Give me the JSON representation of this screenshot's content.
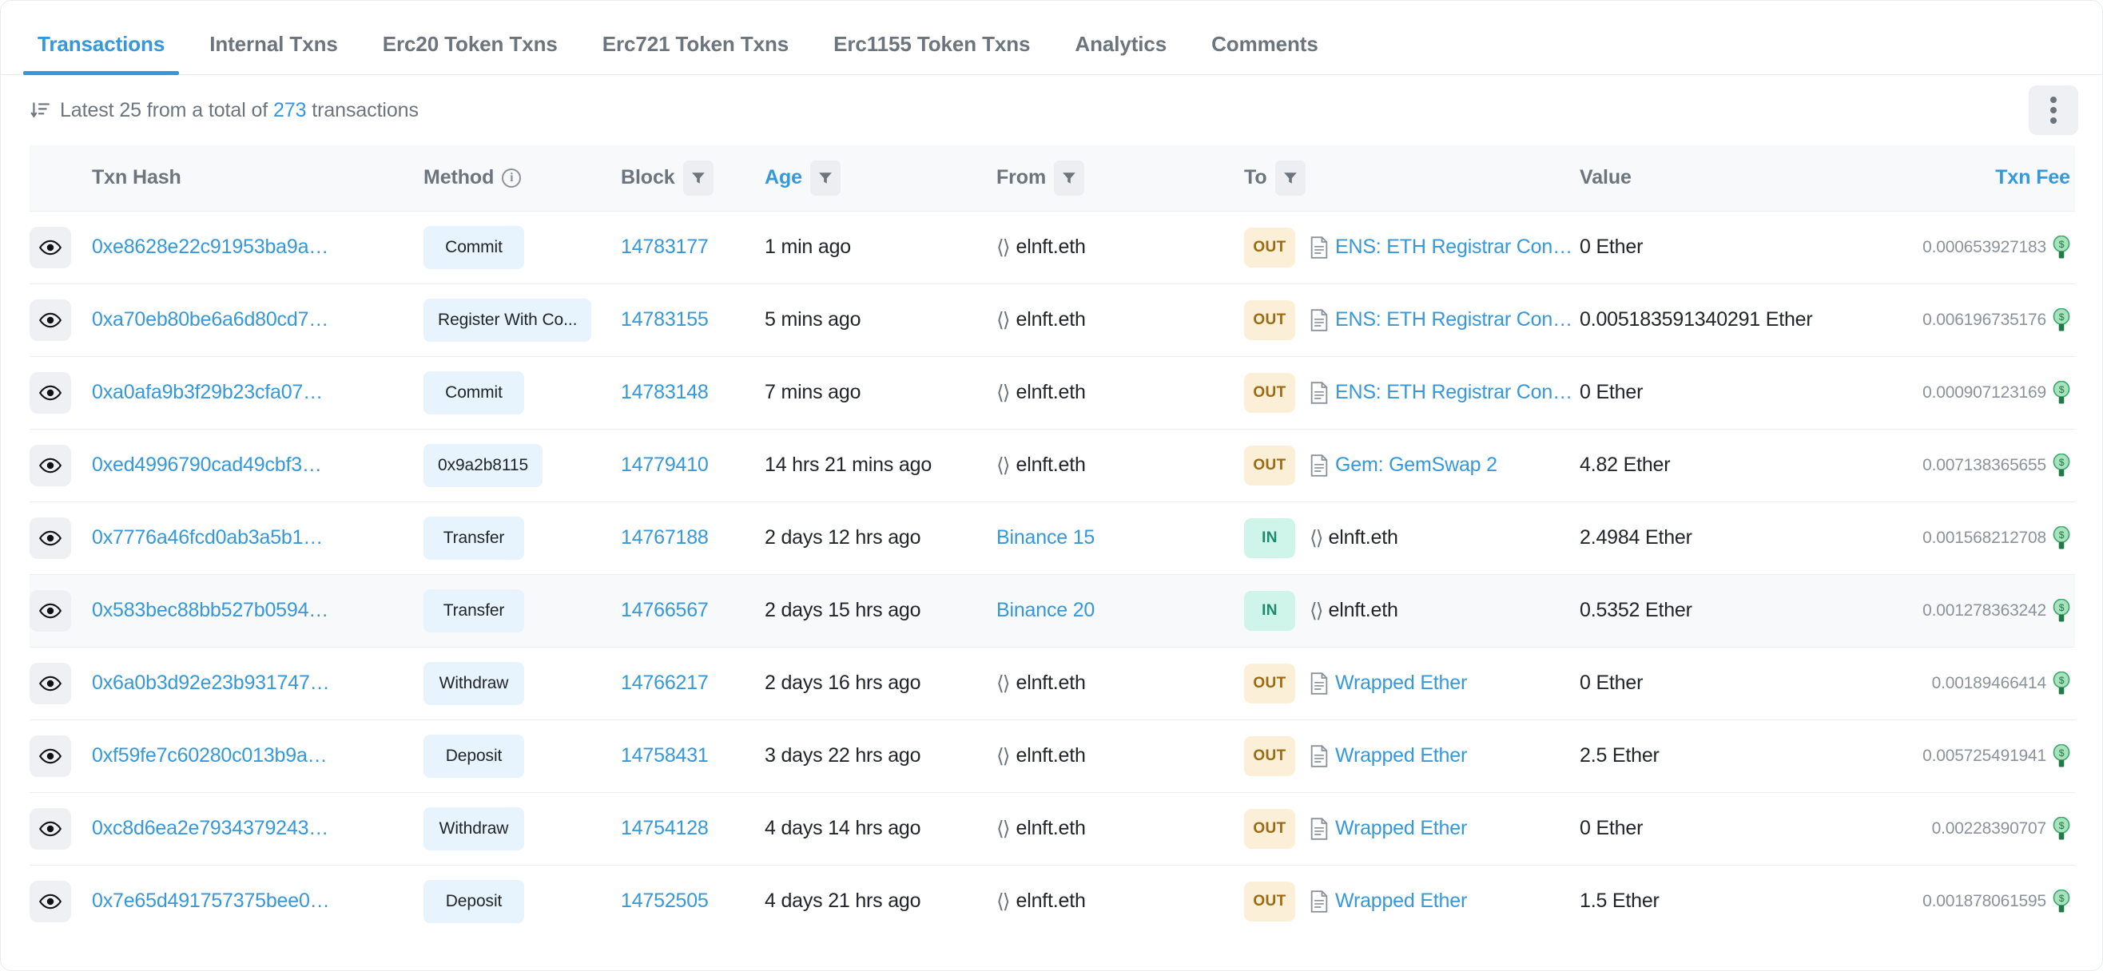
{
  "tabs": [
    {
      "label": "Transactions",
      "active": true
    },
    {
      "label": "Internal Txns",
      "active": false
    },
    {
      "label": "Erc20 Token Txns",
      "active": false
    },
    {
      "label": "Erc721 Token Txns",
      "active": false
    },
    {
      "label": "Erc1155 Token Txns",
      "active": false
    },
    {
      "label": "Analytics",
      "active": false
    },
    {
      "label": "Comments",
      "active": false
    }
  ],
  "summary": {
    "prefix": "Latest 25 from a total of",
    "count": "273",
    "suffix": "transactions",
    "sort_icon": "sort-descending-icon",
    "kebab_icon": "more-options-icon"
  },
  "columns": [
    {
      "key": "eye",
      "label": "",
      "filter": false,
      "info": false,
      "link": false
    },
    {
      "key": "hash",
      "label": "Txn Hash",
      "filter": false,
      "info": false,
      "link": false
    },
    {
      "key": "method",
      "label": "Method",
      "filter": false,
      "info": true,
      "link": false
    },
    {
      "key": "block",
      "label": "Block",
      "filter": true,
      "info": false,
      "link": false
    },
    {
      "key": "age",
      "label": "Age",
      "filter": true,
      "info": false,
      "link": true
    },
    {
      "key": "from",
      "label": "From",
      "filter": true,
      "info": false,
      "link": false
    },
    {
      "key": "to",
      "label": "To",
      "filter": true,
      "info": false,
      "link": false
    },
    {
      "key": "value",
      "label": "Value",
      "filter": false,
      "info": false,
      "link": false
    },
    {
      "key": "fee",
      "label": "Txn Fee",
      "filter": false,
      "info": false,
      "link": true
    }
  ],
  "colors": {
    "link": "#3498db",
    "out_badge_bg": "#fbf0d7",
    "out_badge_fg": "#9b6a12",
    "in_badge_bg": "#cff4ea",
    "in_badge_fg": "#1c8a6e",
    "method_pill_bg": "#e8f4fd",
    "header_bg": "#f8f9fb",
    "shaded_row_bg": "#f8f9fa",
    "muted_text": "#6c757d",
    "fee_text": "#8a929b",
    "gas_icon": "#3aa76d"
  },
  "rows": [
    {
      "hash": "0xe8628e22c91953ba9a…",
      "method": "Commit",
      "block": "14783177",
      "age": "1 min ago",
      "from": "elnft.eth",
      "from_link": false,
      "from_icon": "code-brackets-icon",
      "direction": "OUT",
      "to": "ENS: ETH Registrar Con…",
      "to_link": true,
      "to_icon": "contract-doc-icon",
      "value": "0 Ether",
      "fee": "0.000653927183",
      "shaded": false
    },
    {
      "hash": "0xa70eb80be6a6d80cd7…",
      "method": "Register With Co...",
      "block": "14783155",
      "age": "5 mins ago",
      "from": "elnft.eth",
      "from_link": false,
      "from_icon": "code-brackets-icon",
      "direction": "OUT",
      "to": "ENS: ETH Registrar Con…",
      "to_link": true,
      "to_icon": "contract-doc-icon",
      "value": "0.005183591340291 Ether",
      "fee": "0.006196735176",
      "shaded": false
    },
    {
      "hash": "0xa0afa9b3f29b23cfa07…",
      "method": "Commit",
      "block": "14783148",
      "age": "7 mins ago",
      "from": "elnft.eth",
      "from_link": false,
      "from_icon": "code-brackets-icon",
      "direction": "OUT",
      "to": "ENS: ETH Registrar Con…",
      "to_link": true,
      "to_icon": "contract-doc-icon",
      "value": "0 Ether",
      "fee": "0.000907123169",
      "shaded": false
    },
    {
      "hash": "0xed4996790cad49cbf3…",
      "method": "0x9a2b8115",
      "block": "14779410",
      "age": "14 hrs 21 mins ago",
      "from": "elnft.eth",
      "from_link": false,
      "from_icon": "code-brackets-icon",
      "direction": "OUT",
      "to": "Gem: GemSwap 2",
      "to_link": true,
      "to_icon": "contract-doc-icon",
      "value": "4.82 Ether",
      "fee": "0.007138365655",
      "shaded": false
    },
    {
      "hash": "0x7776a46fcd0ab3a5b1…",
      "method": "Transfer",
      "block": "14767188",
      "age": "2 days 12 hrs ago",
      "from": "Binance 15",
      "from_link": true,
      "from_icon": "",
      "direction": "IN",
      "to": "elnft.eth",
      "to_link": false,
      "to_icon": "code-brackets-icon",
      "value": "2.4984 Ether",
      "fee": "0.001568212708",
      "shaded": false
    },
    {
      "hash": "0x583bec88bb527b0594…",
      "method": "Transfer",
      "block": "14766567",
      "age": "2 days 15 hrs ago",
      "from": "Binance 20",
      "from_link": true,
      "from_icon": "",
      "direction": "IN",
      "to": "elnft.eth",
      "to_link": false,
      "to_icon": "code-brackets-icon",
      "value": "0.5352 Ether",
      "fee": "0.001278363242",
      "shaded": true
    },
    {
      "hash": "0x6a0b3d92e23b931747…",
      "method": "Withdraw",
      "block": "14766217",
      "age": "2 days 16 hrs ago",
      "from": "elnft.eth",
      "from_link": false,
      "from_icon": "code-brackets-icon",
      "direction": "OUT",
      "to": "Wrapped Ether",
      "to_link": true,
      "to_icon": "contract-doc-icon",
      "value": "0 Ether",
      "fee": "0.00189466414",
      "shaded": false
    },
    {
      "hash": "0xf59fe7c60280c013b9a…",
      "method": "Deposit",
      "block": "14758431",
      "age": "3 days 22 hrs ago",
      "from": "elnft.eth",
      "from_link": false,
      "from_icon": "code-brackets-icon",
      "direction": "OUT",
      "to": "Wrapped Ether",
      "to_link": true,
      "to_icon": "contract-doc-icon",
      "value": "2.5 Ether",
      "fee": "0.005725491941",
      "shaded": false
    },
    {
      "hash": "0xc8d6ea2e7934379243…",
      "method": "Withdraw",
      "block": "14754128",
      "age": "4 days 14 hrs ago",
      "from": "elnft.eth",
      "from_link": false,
      "from_icon": "code-brackets-icon",
      "direction": "OUT",
      "to": "Wrapped Ether",
      "to_link": true,
      "to_icon": "contract-doc-icon",
      "value": "0 Ether",
      "fee": "0.00228390707",
      "shaded": false
    },
    {
      "hash": "0x7e65d491757375bee0…",
      "method": "Deposit",
      "block": "14752505",
      "age": "4 days 21 hrs ago",
      "from": "elnft.eth",
      "from_link": false,
      "from_icon": "code-brackets-icon",
      "direction": "OUT",
      "to": "Wrapped Ether",
      "to_link": true,
      "to_icon": "contract-doc-icon",
      "value": "1.5 Ether",
      "fee": "0.001878061595",
      "shaded": false
    }
  ]
}
